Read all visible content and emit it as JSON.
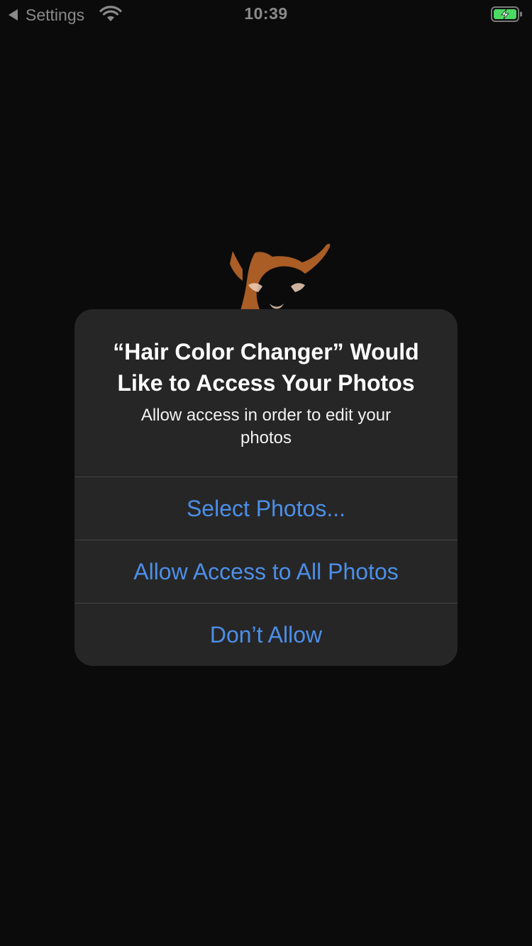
{
  "status_bar": {
    "back_label": "Settings",
    "time": "10:39",
    "icons": [
      "back-arrow-icon",
      "wifi-icon",
      "battery-charging-icon"
    ],
    "battery_color": "#4cd964"
  },
  "alert": {
    "title": "“Hair Color Changer” Would Like to Access Your Photos",
    "message": "Allow access in order to edit your photos",
    "buttons": [
      {
        "label": "Select Photos..."
      },
      {
        "label": "Allow Access to All Photos"
      },
      {
        "label": "Don’t Allow"
      }
    ],
    "button_color": "#4c8fe8"
  },
  "background": {
    "mascot_icon": "tiger-mascot-icon",
    "mascot_color": "#e07a2f"
  }
}
